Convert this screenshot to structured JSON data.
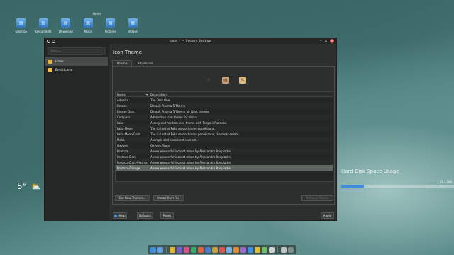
{
  "desktop": {
    "folder_view_title": "Home",
    "icons": [
      {
        "label": "Desktop",
        "icon": "folder-icon"
      },
      {
        "label": "Documents",
        "icon": "folder-icon"
      },
      {
        "label": "Download",
        "icon": "folder-icon"
      },
      {
        "label": "Music",
        "icon": "folder-icon"
      },
      {
        "label": "Pictures",
        "icon": "folder-icon"
      },
      {
        "label": "Videos",
        "icon": "folder-icon"
      }
    ],
    "weather": {
      "temperature": "5°"
    },
    "hdd_widget": {
      "title": "Hard Disk Space Usage",
      "size_label": "31.1 GiB",
      "usage_fraction": 0.2
    }
  },
  "window": {
    "title": "Icons * — System Settings",
    "sidebar": {
      "search_placeholder": "Search",
      "items": [
        {
          "label": "Icons",
          "active": true,
          "color": "#e0b33a"
        },
        {
          "label": "Emoticons",
          "active": false,
          "color": "#f0c24a"
        }
      ]
    },
    "heading": "Icon Theme",
    "tabs": [
      {
        "label": "Theme",
        "active": true
      },
      {
        "label": "Advanced",
        "active": false
      }
    ],
    "table": {
      "columns": [
        "Name",
        "Description"
      ],
      "rows": [
        {
          "name": "Adwaita",
          "desc": "The Only One"
        },
        {
          "name": "Breeze",
          "desc": "Default Plasma 5 Theme"
        },
        {
          "name": "Breeze Dark",
          "desc": "Default Plasma 5 Theme for Dark themes"
        },
        {
          "name": "Compass",
          "desc": "Alternative icon theme for Nitrux"
        },
        {
          "name": "Faba",
          "desc": "A sexy and modern icon theme with Tango influences."
        },
        {
          "name": "Faba-Mono",
          "desc": "The full set of Faba monochrome panel icons."
        },
        {
          "name": "Faba-Mono-Dark",
          "desc": "The full set of Faba monochrome panel icons, the dark variant."
        },
        {
          "name": "Moka",
          "desc": "A simple and consistent icon set."
        },
        {
          "name": "Oxygen",
          "desc": "Oxygen Team"
        },
        {
          "name": "Polenza",
          "desc": "A new wonderful iconset made by Alessandro Bonpiadre."
        },
        {
          "name": "Potenza-Dark",
          "desc": "A new wonderful iconset made by Alessandro Bonpiadre."
        },
        {
          "name": "Potenza-Dark-Plasma",
          "desc": "A new wonderful iconset made by Alessandro Bonpiadre."
        },
        {
          "name": "Potenza-Orange",
          "desc": "A new wonderful iconset made by Alessandro Bonpiadre.",
          "selected": true
        }
      ]
    },
    "buttons": {
      "get_new": "Get New Themes...",
      "install": "Install from File",
      "remove": "Remove Theme",
      "help": "Help",
      "defaults": "Defaults",
      "reset": "Reset",
      "apply": "Apply"
    }
  },
  "dock": {
    "items": [
      "#3d8ee0",
      "#5aa0e8",
      "#e0b33a",
      "#7a5cc9",
      "#d94f8a",
      "#3aa66a",
      "#e0603a",
      "#4a7bd0",
      "#c9a13a",
      "#d9534f",
      "#7ab0e0",
      "#e08a3a",
      "#9a6ad0",
      "#3d8ee0",
      "#e0c03a",
      "#6fbf6f",
      "#d0d0d0",
      "#bfc4c3",
      "#7f8a89"
    ]
  }
}
